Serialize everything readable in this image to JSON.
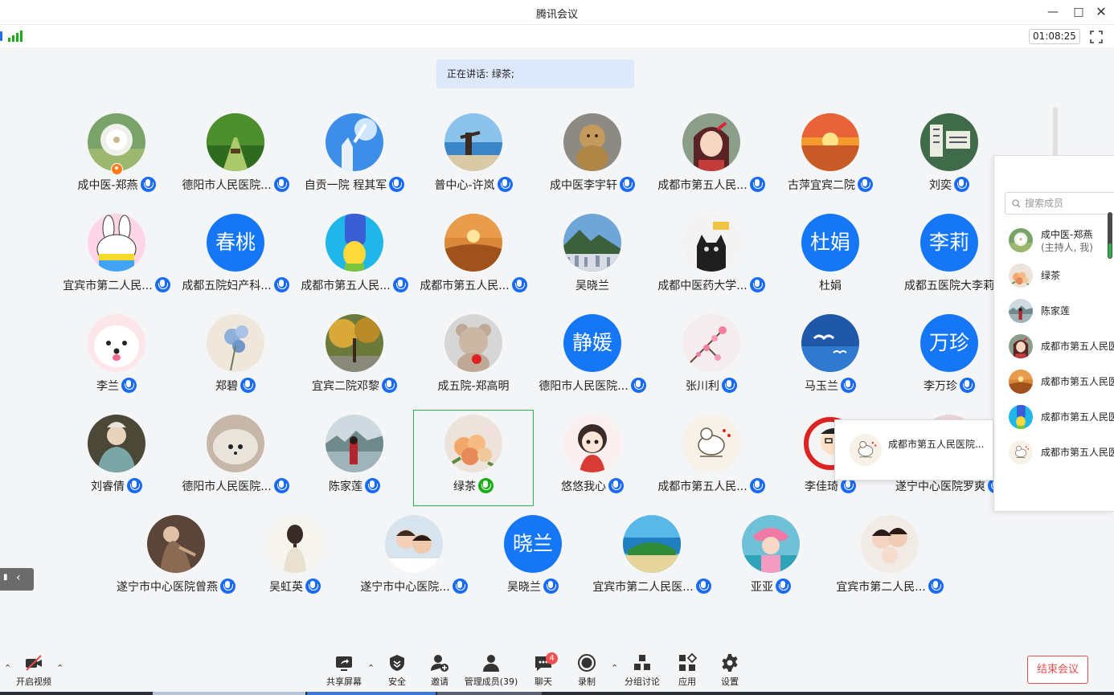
{
  "window": {
    "title": "腾讯会议"
  },
  "header": {
    "timer": "01:08:25"
  },
  "speaking": {
    "text": "正在讲话: 绿茶;"
  },
  "members": [
    {
      "name": "成中医-郑燕",
      "av": "dandelion",
      "host": true
    },
    {
      "name": "德阳市人民医院...",
      "av": "forest"
    },
    {
      "name": "自贡一院 程其军",
      "av": "sky"
    },
    {
      "name": "普中心-许岚",
      "av": "beach"
    },
    {
      "name": "成中医李宇轩",
      "av": "monkey"
    },
    {
      "name": "成都市第五人民...",
      "av": "anime"
    },
    {
      "name": "古萍宜宾二院",
      "av": "sunset"
    },
    {
      "name": "刘奕",
      "av": "green"
    },
    {
      "name": "宜宾市第二人民...",
      "av": "rabbit"
    },
    {
      "name": "成都五院妇产科...",
      "av": "text",
      "avtext": "春桃"
    },
    {
      "name": "成都市第五人民...",
      "av": "marge"
    },
    {
      "name": "成都市第五人民...",
      "av": "desert"
    },
    {
      "name": "吴晓兰",
      "av": "city",
      "nomic": true
    },
    {
      "name": "成都中医药大学...",
      "av": "cat"
    },
    {
      "name": "杜娟",
      "av": "text",
      "avtext": "杜娟",
      "nomic": true
    },
    {
      "name": "成都五医院大李莉",
      "av": "text",
      "avtext": "李莉",
      "nomic": true
    },
    {
      "name": "李兰",
      "av": "dog"
    },
    {
      "name": "郑碧",
      "av": "flower"
    },
    {
      "name": "宜宾二院邓黎",
      "av": "autumn"
    },
    {
      "name": "成五院-郑高明",
      "av": "teddy",
      "nomic": true
    },
    {
      "name": "德阳市人民医院...",
      "av": "text",
      "avtext": "静媛"
    },
    {
      "name": "张川利",
      "av": "blossom"
    },
    {
      "name": "马玉兰",
      "av": "gulls"
    },
    {
      "name": "李万珍",
      "av": "text",
      "avtext": "万珍"
    },
    {
      "name": "刘睿倩",
      "av": "painting"
    },
    {
      "name": "德阳市人民医院...",
      "av": "hedgehog"
    },
    {
      "name": "陈家莲",
      "av": "lake"
    },
    {
      "name": "绿茶",
      "av": "bouquet",
      "active": true
    },
    {
      "name": "悠悠我心",
      "av": "doll"
    },
    {
      "name": "成都市第五人民...",
      "av": "sketch"
    },
    {
      "name": "李佳琦",
      "av": "cartoon"
    },
    {
      "name": "遂宁中心医院罗爽",
      "av": "pink"
    },
    {
      "name": "遂宁市中心医院曾燕",
      "av": "lady"
    },
    {
      "name": "吴虹英",
      "av": "girlback"
    },
    {
      "name": "遂宁市中心医院...",
      "av": "kids"
    },
    {
      "name": "吴晓兰",
      "av": "text",
      "avtext": "晓兰"
    },
    {
      "name": "宜宾市第二人民医...",
      "av": "island"
    },
    {
      "name": "亚亚",
      "av": "child"
    },
    {
      "name": "宜宾市第二人民...",
      "av": "family"
    }
  ],
  "panel": {
    "search_placeholder": "搜索成员",
    "items": [
      {
        "name": "成中医-郑燕",
        "sub": "(主持人, 我)",
        "av": "dandelion"
      },
      {
        "name": "绿茶",
        "av": "bouquet"
      },
      {
        "name": "陈家莲",
        "av": "lake"
      },
      {
        "name": "成都市第五人民医",
        "av": "anime"
      },
      {
        "name": "成都市第五人民医",
        "av": "desert"
      },
      {
        "name": "成都市第五人民医",
        "av": "marge"
      },
      {
        "name": "成都市第五人民医",
        "av": "sketch"
      }
    ]
  },
  "tooltip": {
    "name": "成都市第五人民医院...",
    "av": "sketch"
  },
  "toolbar": {
    "video": "开启视频",
    "share": "共享屏幕",
    "security": "安全",
    "invite": "邀请",
    "members": "管理成员(39)",
    "chat": "聊天",
    "chat_badge": "4",
    "record": "录制",
    "breakout": "分组讨论",
    "apps": "应用",
    "settings": "设置",
    "end": "结束会议"
  },
  "colors": {
    "accent": "#1677f6",
    "speaking_bg": "#dde9fb",
    "active_border": "#2bb24c",
    "end": "#e54d4d"
  }
}
